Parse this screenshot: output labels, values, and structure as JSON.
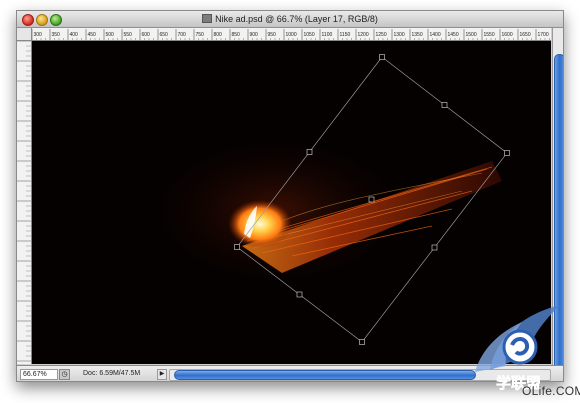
{
  "window": {
    "title": "Nike ad.psd @ 66.7% (Layer 17, RGB/8)"
  },
  "ruler": {
    "top_labels": [
      "300",
      "350",
      "400",
      "450",
      "500",
      "550",
      "600",
      "650",
      "700",
      "750",
      "800",
      "850",
      "900",
      "950",
      "1000",
      "1050",
      "1100",
      "1150",
      "1200",
      "1250",
      "1300",
      "1350",
      "1400",
      "1450",
      "1500",
      "1550",
      "1600",
      "1650",
      "1700"
    ]
  },
  "status": {
    "zoom": "66.67%",
    "docinfo": "Doc: 6.59M/47.5M"
  },
  "watermark": {
    "text": "OLife.COM",
    "logo_text": "学联盟"
  },
  "colors": {
    "canvas": "#050101",
    "scroll_accent": "#2f6fcd",
    "flame": "#ff8a1a"
  },
  "icons": {
    "close": "close-icon",
    "minimize": "minimize-icon",
    "zoom": "zoom-icon",
    "document": "document-icon",
    "status_menu": "status-menu-icon"
  }
}
